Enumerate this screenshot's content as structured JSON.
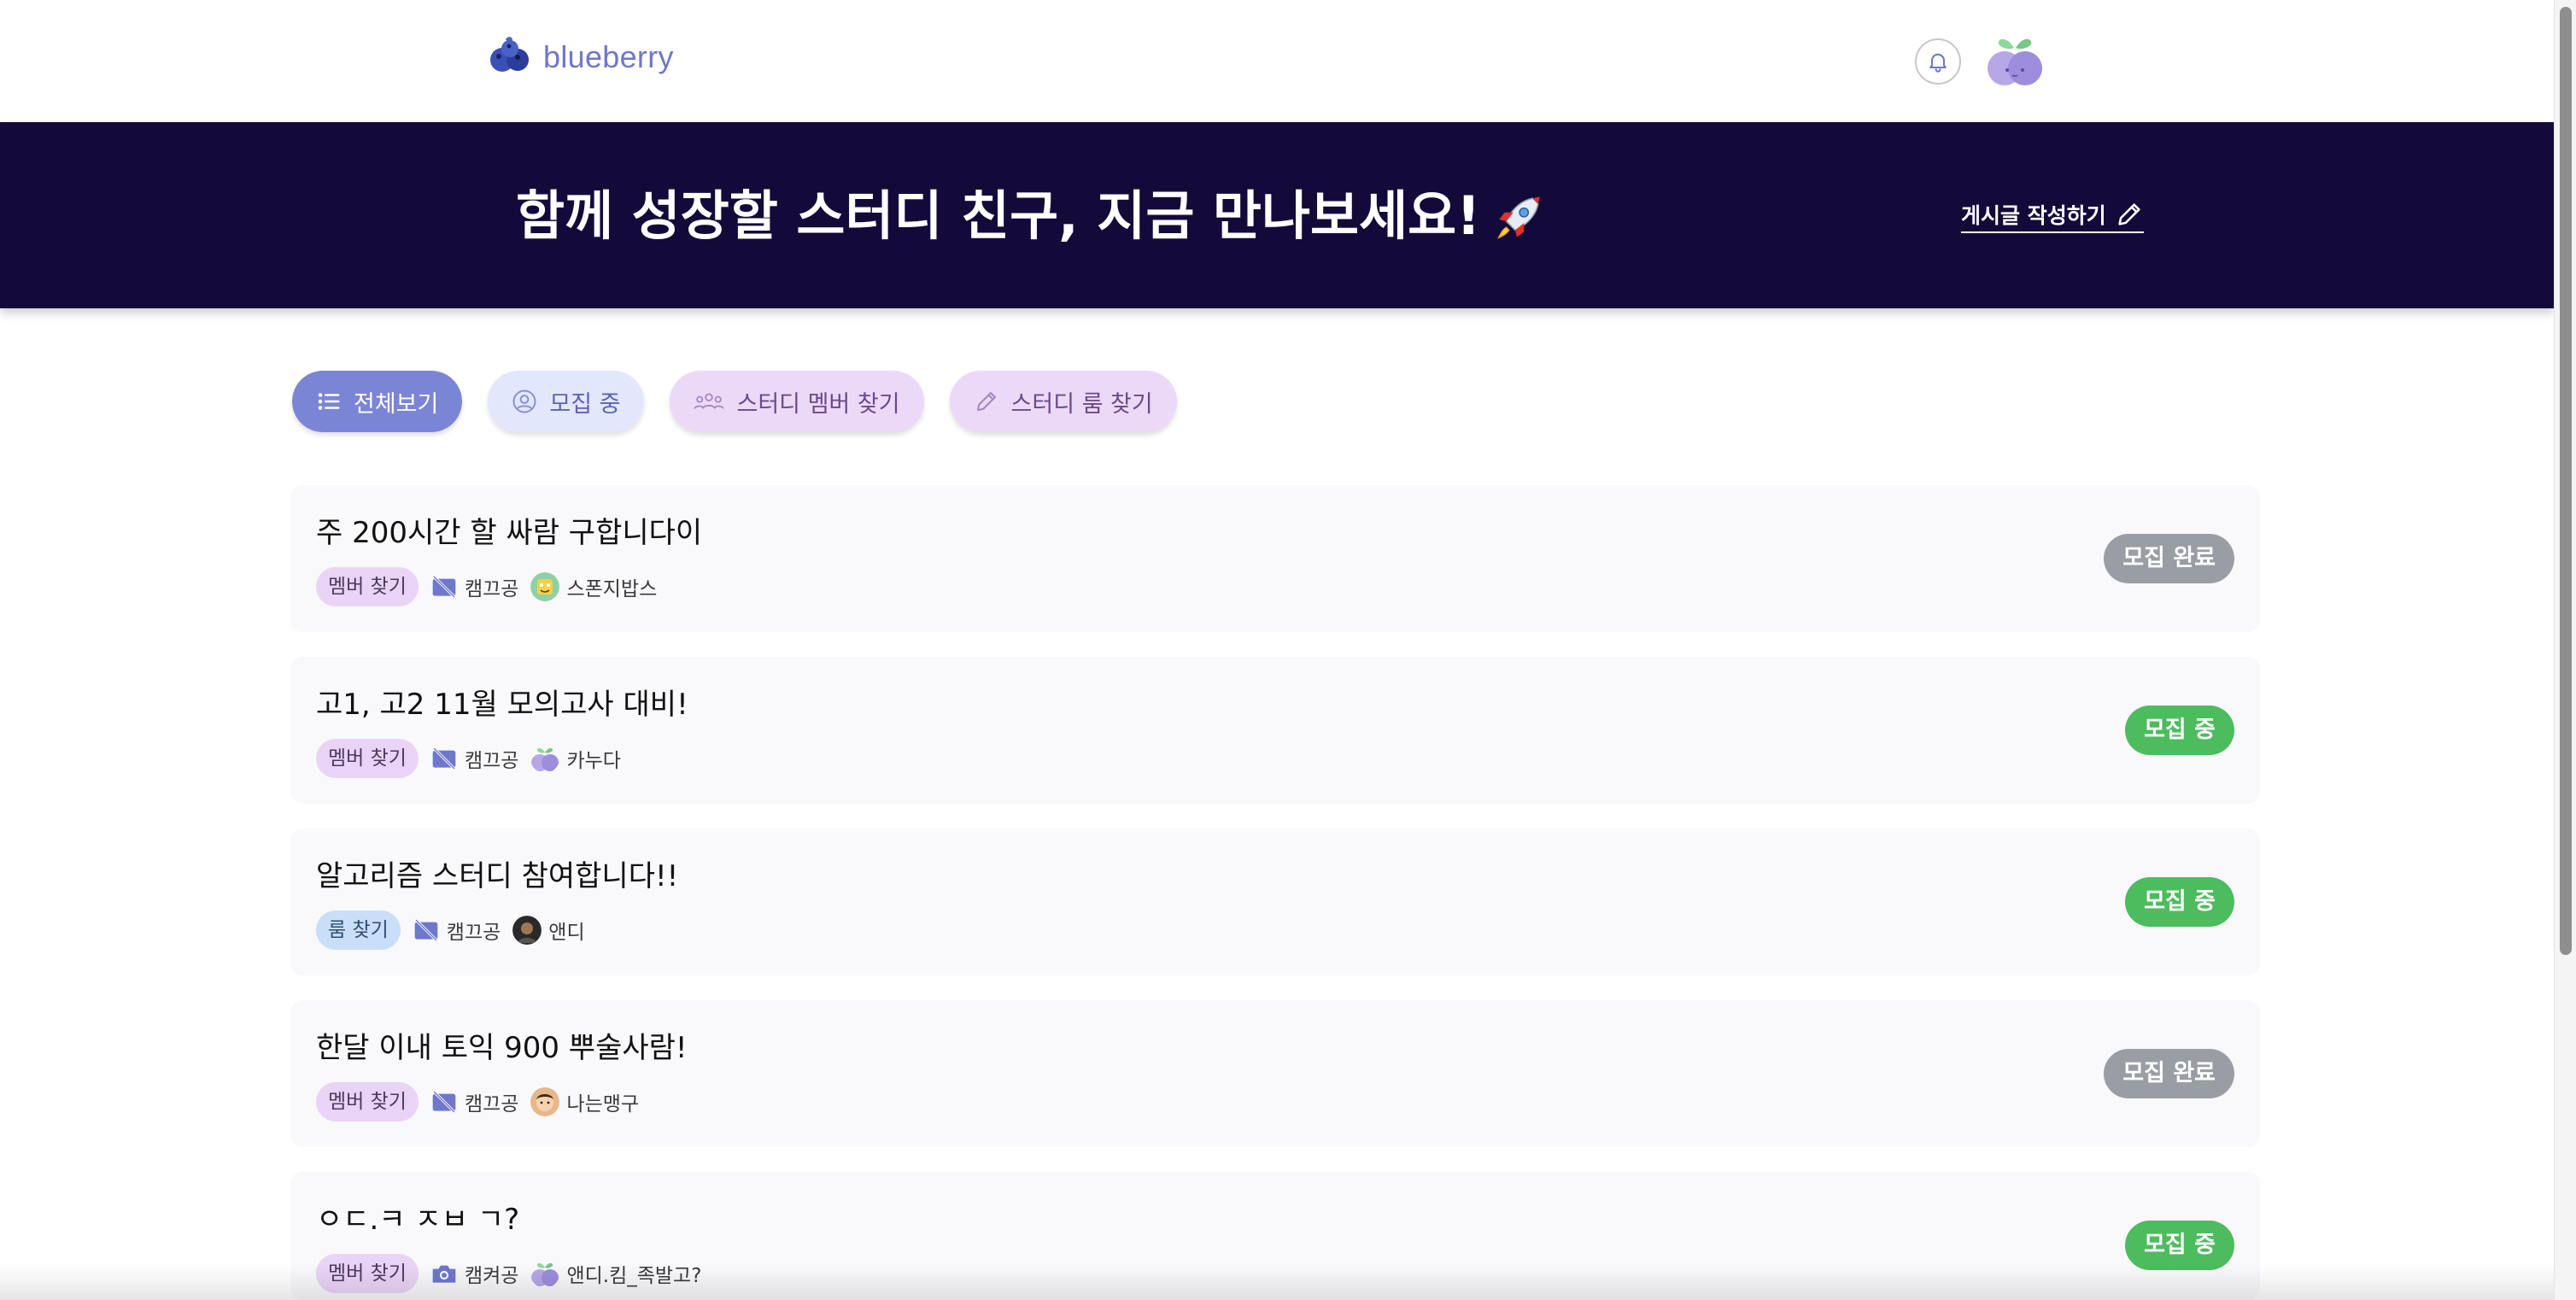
{
  "header": {
    "brand": "blueberry",
    "notifications_icon": "bell-icon",
    "profile_icon": "blueberry-avatar-icon"
  },
  "hero": {
    "title": "함께 성장할 스터디 친구, 지금 만나보세요!",
    "title_emoji": "rocket-icon",
    "write_label": "게시글 작성하기",
    "write_icon": "pencil-icon"
  },
  "filters": [
    {
      "label": "전체보기",
      "icon": "list-icon",
      "selected": true
    },
    {
      "label": "모집 중",
      "icon": "user-circle-icon",
      "selected": false
    },
    {
      "label": "스터디 멤버 찾기",
      "icon": "people-icon",
      "selected": false
    },
    {
      "label": "스터디 룸 찾기",
      "icon": "pencil-icon",
      "selected": false
    }
  ],
  "posts": [
    {
      "title": "주 200시간 할 싸람 구합니다이",
      "tag": "멤버 찾기",
      "mode": "캠끄공",
      "mode_icon": "camera-off-icon",
      "author": "스폰지밥스",
      "status": "모집 완료"
    },
    {
      "title": "고1, 고2 11월 모의고사 대비!",
      "tag": "멤버 찾기",
      "mode": "캠끄공",
      "mode_icon": "camera-off-icon",
      "author": "카누다",
      "status": "모집 중"
    },
    {
      "title": "알고리즘 스터디 참여합니다!!",
      "tag": "룸 찾기",
      "mode": "캠끄공",
      "mode_icon": "camera-off-icon",
      "author": "앤디",
      "status": "모집 중"
    },
    {
      "title": "한달 이내 토익 900 뿌술사람!",
      "tag": "멤버 찾기",
      "mode": "캠끄공",
      "mode_icon": "camera-off-icon",
      "author": "나는맹구",
      "status": "모집 완료"
    },
    {
      "title": "ㅇㄷ.ㅋ ㅈㅂ ㄱ?",
      "tag": "멤버 찾기",
      "mode": "캠켜공",
      "mode_icon": "camera-icon",
      "author": "앤디.킴_족발고?",
      "status": "모집 중"
    }
  ],
  "colors": {
    "brand": "#6f77cc",
    "hero_bg": "#140a3a",
    "status_open": "#4cbc5e",
    "status_done": "#9a9da3",
    "chip_selected": "#7b85d6"
  }
}
